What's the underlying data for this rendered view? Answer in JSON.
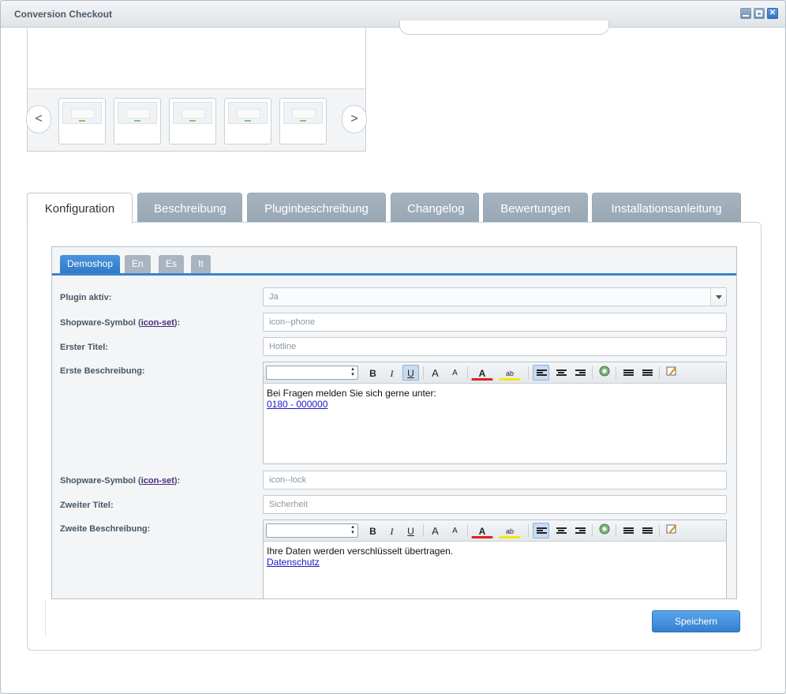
{
  "window": {
    "title": "Conversion Checkout",
    "controls": {
      "minimize": "minimize",
      "maximize": "maximize",
      "close": "✕"
    }
  },
  "gallery": {
    "prev_label": "<",
    "next_label": ">",
    "thumbnail_count": 5
  },
  "tabs": [
    {
      "label": "Konfiguration",
      "active": true
    },
    {
      "label": "Beschreibung",
      "active": false
    },
    {
      "label": "Pluginbeschreibung",
      "active": false
    },
    {
      "label": "Changelog",
      "active": false
    },
    {
      "label": "Bewertungen",
      "active": false
    },
    {
      "label": "Installationsanleitung",
      "active": false
    }
  ],
  "shop_tabs": [
    {
      "label": "Demoshop",
      "active": true
    },
    {
      "label": "En",
      "active": false
    },
    {
      "label": "Es",
      "active": false
    },
    {
      "label": "It",
      "active": false
    }
  ],
  "form": {
    "plugin_active": {
      "label": "Plugin aktiv:",
      "value": "Ja"
    },
    "symbol1": {
      "label_prefix": "Shopware-Symbol (",
      "link": "icon-set",
      "label_suffix": "):",
      "value": "icon--phone"
    },
    "title1": {
      "label": "Erster Titel:",
      "value": "Hotline"
    },
    "desc1": {
      "label": "Erste Beschreibung:",
      "line1": "Bei Fragen melden Sie sich gerne unter:",
      "link": "0180 - 000000"
    },
    "symbol2": {
      "label_prefix": "Shopware-Symbol (",
      "link": "icon-set",
      "label_suffix": "):",
      "value": "icon--lock"
    },
    "title2": {
      "label": "Zweiter Titel:",
      "value": "Sicherheit"
    },
    "desc2": {
      "label": "Zweite Beschreibung:",
      "line1": "Ihre Daten werden verschlüsselt übertragen.",
      "link": "Datenschutz"
    }
  },
  "toolbar": {
    "bold": "B",
    "italic": "I",
    "underline": "U",
    "grow": "A",
    "shrink": "A",
    "font_color": "A",
    "highlight": "ab",
    "colors": {
      "font_color": "#e02020",
      "highlight": "#f5e600"
    }
  },
  "actions": {
    "save_label": "Speichern"
  }
}
